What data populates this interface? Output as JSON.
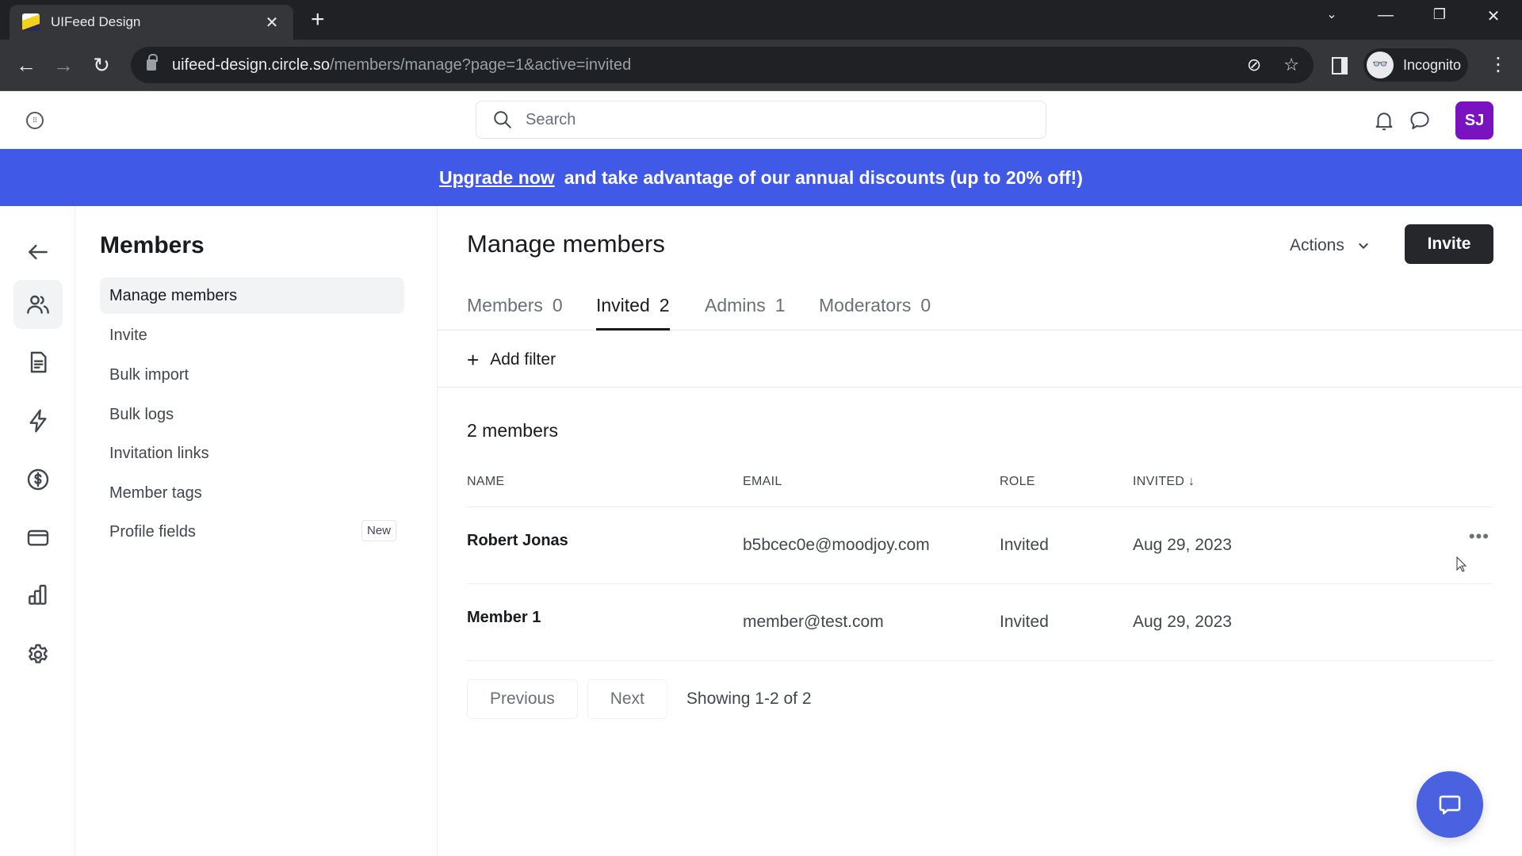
{
  "browser": {
    "tab_title": "UIFeed Design",
    "url_host": "uifeed-design.circle.so",
    "url_path": "/members/manage?page=1&active=invited",
    "profile_label": "Incognito"
  },
  "header": {
    "search_placeholder": "Search",
    "avatar_initials": "SJ",
    "avatar_color": "#7a12c0"
  },
  "banner": {
    "link_text": "Upgrade now",
    "message": "and take advantage of our annual discounts (up to 20% off!)",
    "background": "#4159e7"
  },
  "rail": {
    "items": [
      {
        "icon": "back-arrow-icon",
        "active": false
      },
      {
        "icon": "members-icon",
        "active": true
      },
      {
        "icon": "document-icon",
        "active": false
      },
      {
        "icon": "lightning-icon",
        "active": false
      },
      {
        "icon": "dollar-icon",
        "active": false
      },
      {
        "icon": "credit-card-icon",
        "active": false
      },
      {
        "icon": "analytics-icon",
        "active": false
      },
      {
        "icon": "settings-icon",
        "active": false
      }
    ]
  },
  "submenu": {
    "title": "Members",
    "items": [
      {
        "label": "Manage members",
        "active": true
      },
      {
        "label": "Invite"
      },
      {
        "label": "Bulk import"
      },
      {
        "label": "Bulk logs"
      },
      {
        "label": "Invitation links"
      },
      {
        "label": "Member tags"
      },
      {
        "label": "Profile fields",
        "badge": "New"
      }
    ]
  },
  "main": {
    "title": "Manage members",
    "actions_label": "Actions",
    "invite_label": "Invite",
    "tabs": [
      {
        "label": "Members",
        "count": "0"
      },
      {
        "label": "Invited",
        "count": "2",
        "active": true
      },
      {
        "label": "Admins",
        "count": "1"
      },
      {
        "label": "Moderators",
        "count": "0"
      }
    ],
    "add_filter_label": "Add filter",
    "count_label": "2 members",
    "table": {
      "headers": [
        "NAME",
        "EMAIL",
        "ROLE",
        "INVITED"
      ],
      "sort_indicator": "↓",
      "rows": [
        {
          "name": "Robert Jonas",
          "email": "b5bcec0e@moodjoy.com",
          "role": "Invited",
          "invited": "Aug 29, 2023"
        },
        {
          "name": "Member 1",
          "email": "member@test.com",
          "role": "Invited",
          "invited": "Aug 29, 2023"
        }
      ]
    },
    "pagination": {
      "previous_label": "Previous",
      "next_label": "Next",
      "status": "Showing 1-2 of 2"
    }
  }
}
